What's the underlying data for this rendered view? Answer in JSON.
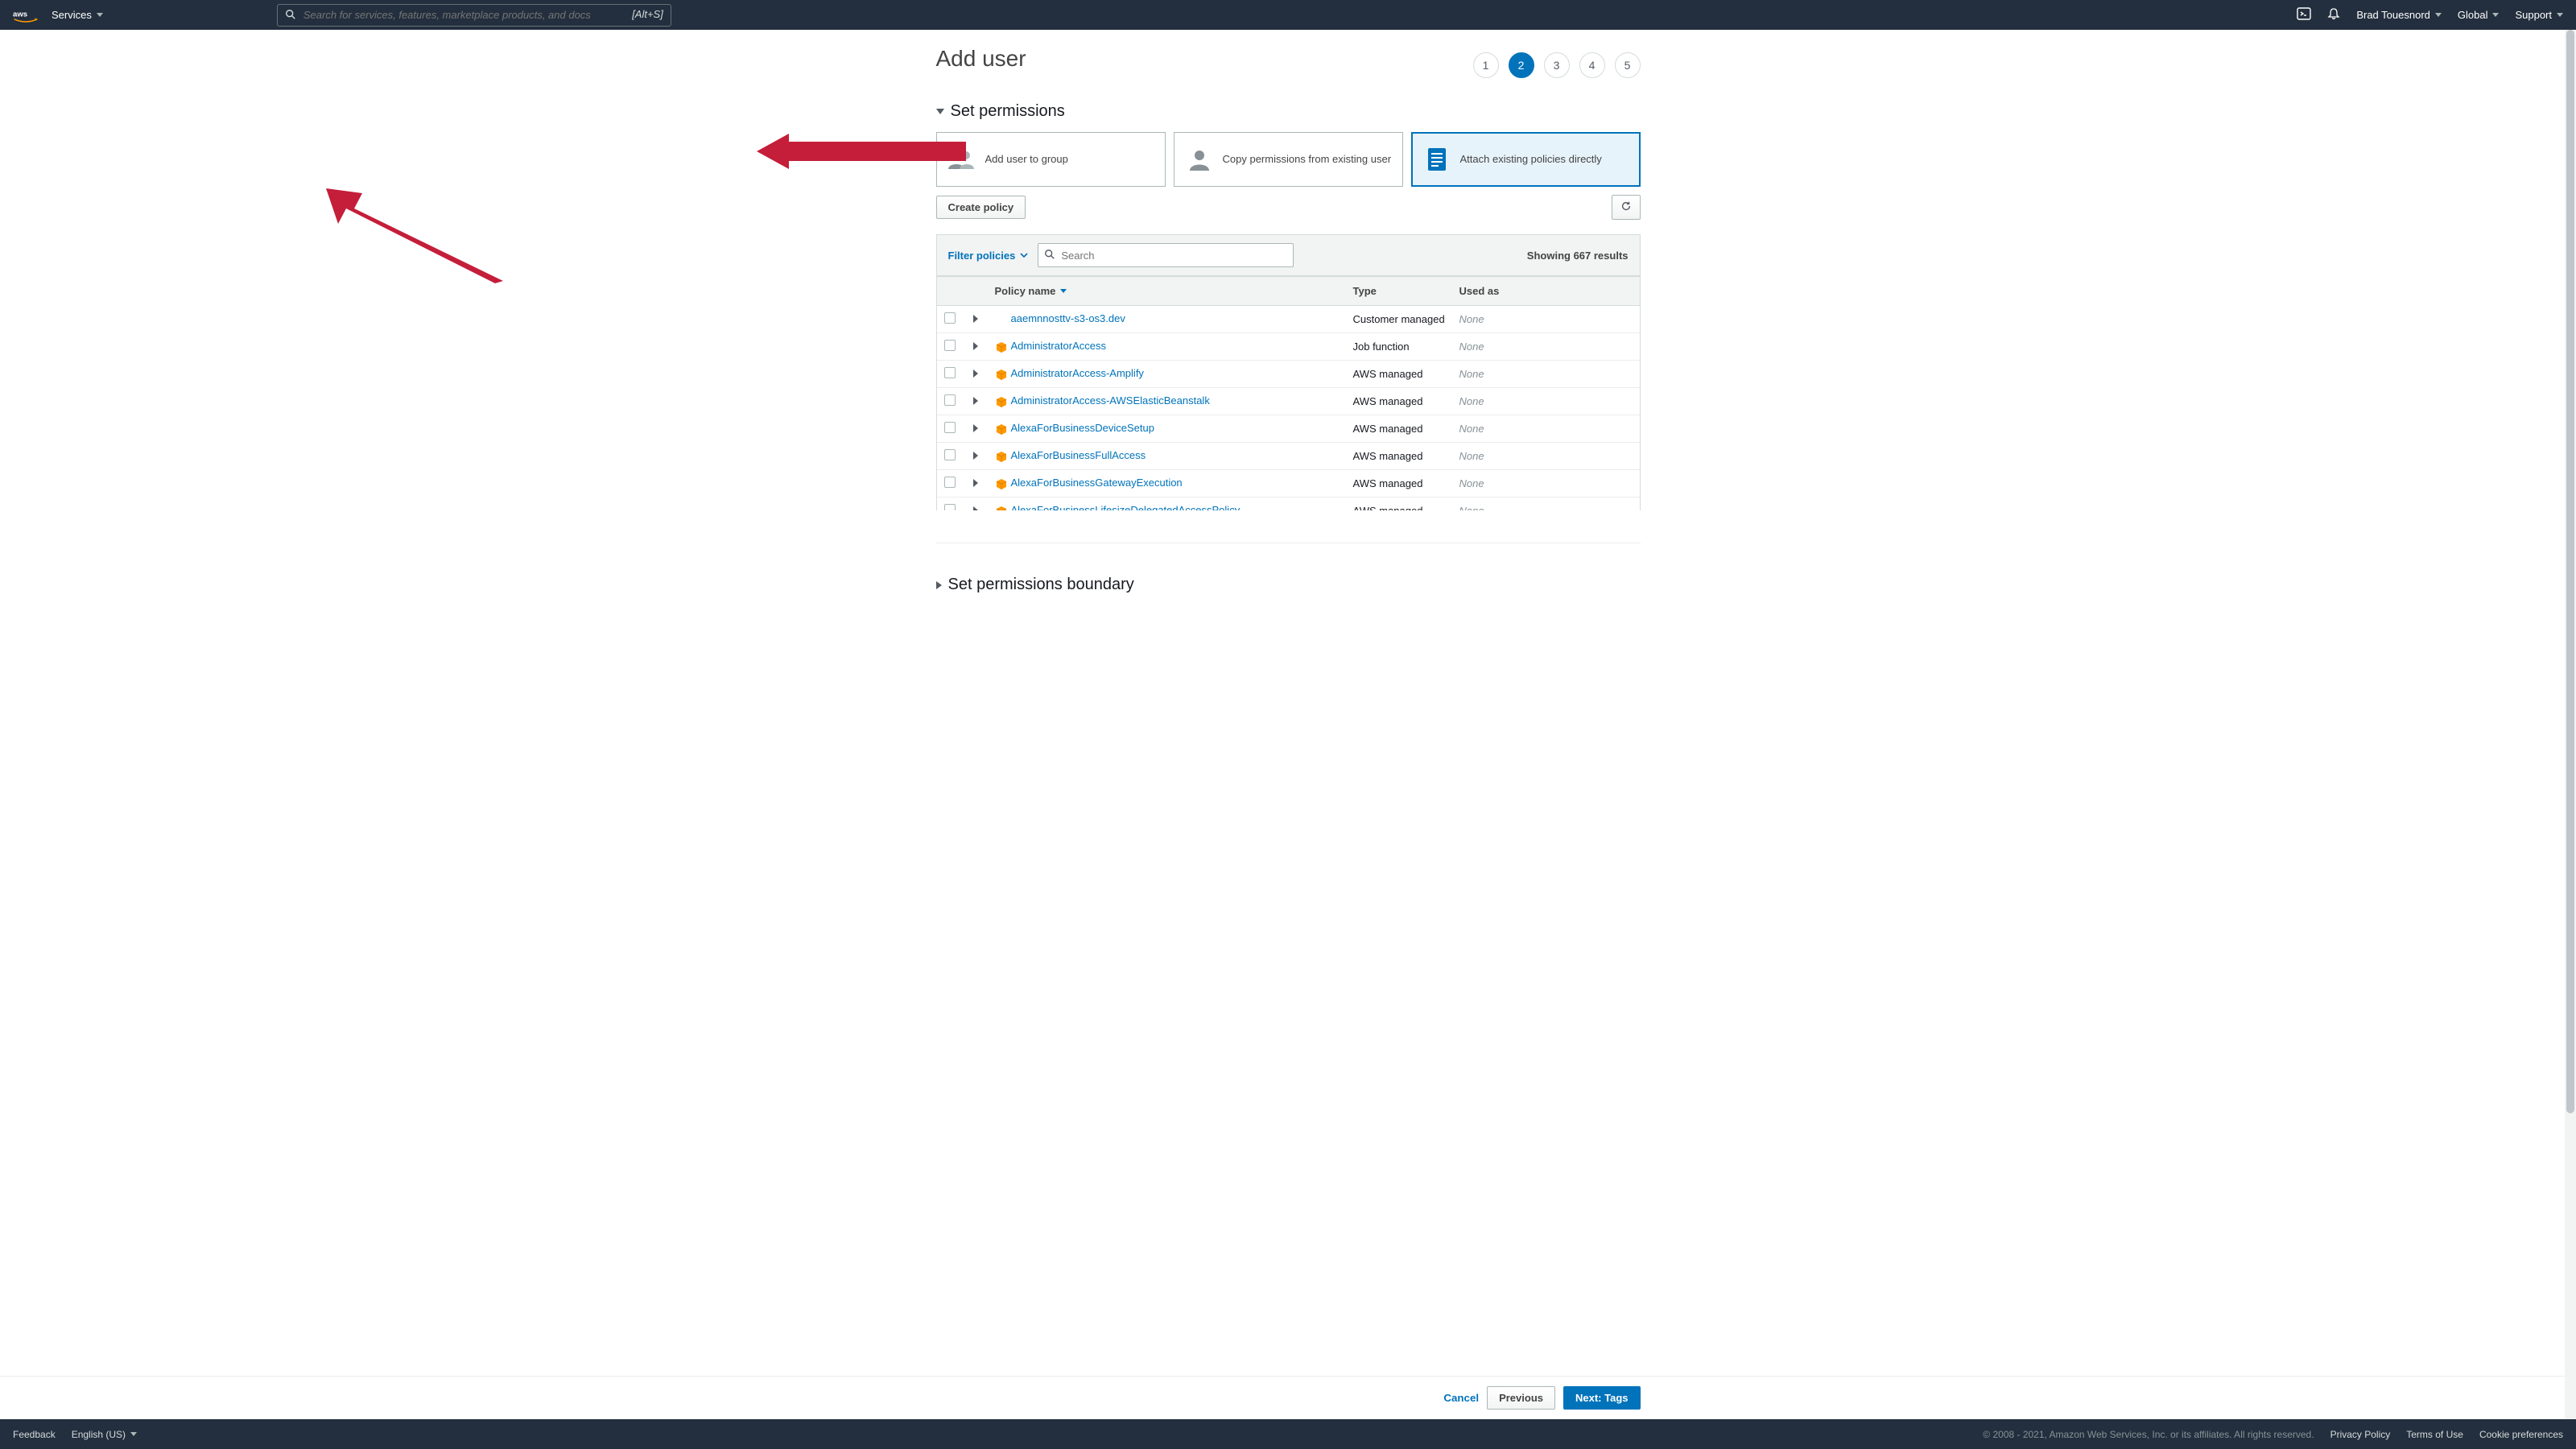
{
  "nav": {
    "services": "Services",
    "search_placeholder": "Search for services, features, marketplace products, and docs",
    "search_hint": "[Alt+S]",
    "user": "Brad Touesnord",
    "region": "Global",
    "support": "Support"
  },
  "page": {
    "title": "Add user",
    "steps": [
      "1",
      "2",
      "3",
      "4",
      "5"
    ],
    "active_step": 2
  },
  "permissions": {
    "section_label": "Set permissions",
    "options": {
      "add_group": "Add user to group",
      "copy": "Copy permissions from existing user",
      "attach": "Attach existing policies directly"
    },
    "create_policy": "Create policy",
    "filter_label": "Filter policies",
    "search_placeholder": "Search",
    "results_count": "Showing 667 results",
    "columns": {
      "name": "Policy name",
      "type": "Type",
      "used": "Used as"
    },
    "rows": [
      {
        "name": "aaemnnosttv-s3-os3.dev",
        "type": "Customer managed",
        "used": "None",
        "icon": false
      },
      {
        "name": "AdministratorAccess",
        "type": "Job function",
        "used": "None",
        "icon": true
      },
      {
        "name": "AdministratorAccess-Amplify",
        "type": "AWS managed",
        "used": "None",
        "icon": true
      },
      {
        "name": "AdministratorAccess-AWSElasticBeanstalk",
        "type": "AWS managed",
        "used": "None",
        "icon": true
      },
      {
        "name": "AlexaForBusinessDeviceSetup",
        "type": "AWS managed",
        "used": "None",
        "icon": true
      },
      {
        "name": "AlexaForBusinessFullAccess",
        "type": "AWS managed",
        "used": "None",
        "icon": true
      },
      {
        "name": "AlexaForBusinessGatewayExecution",
        "type": "AWS managed",
        "used": "None",
        "icon": true
      },
      {
        "name": "AlexaForBusinessLifesizeDelegatedAccessPolicy",
        "type": "AWS managed",
        "used": "None",
        "icon": true
      }
    ]
  },
  "boundary": {
    "section_label": "Set permissions boundary"
  },
  "actions": {
    "cancel": "Cancel",
    "previous": "Previous",
    "next": "Next: Tags"
  },
  "footer": {
    "feedback": "Feedback",
    "language": "English (US)",
    "copyright": "© 2008 - 2021, Amazon Web Services, Inc. or its affiliates. All rights reserved.",
    "privacy": "Privacy Policy",
    "terms": "Terms of Use",
    "cookies": "Cookie preferences"
  }
}
